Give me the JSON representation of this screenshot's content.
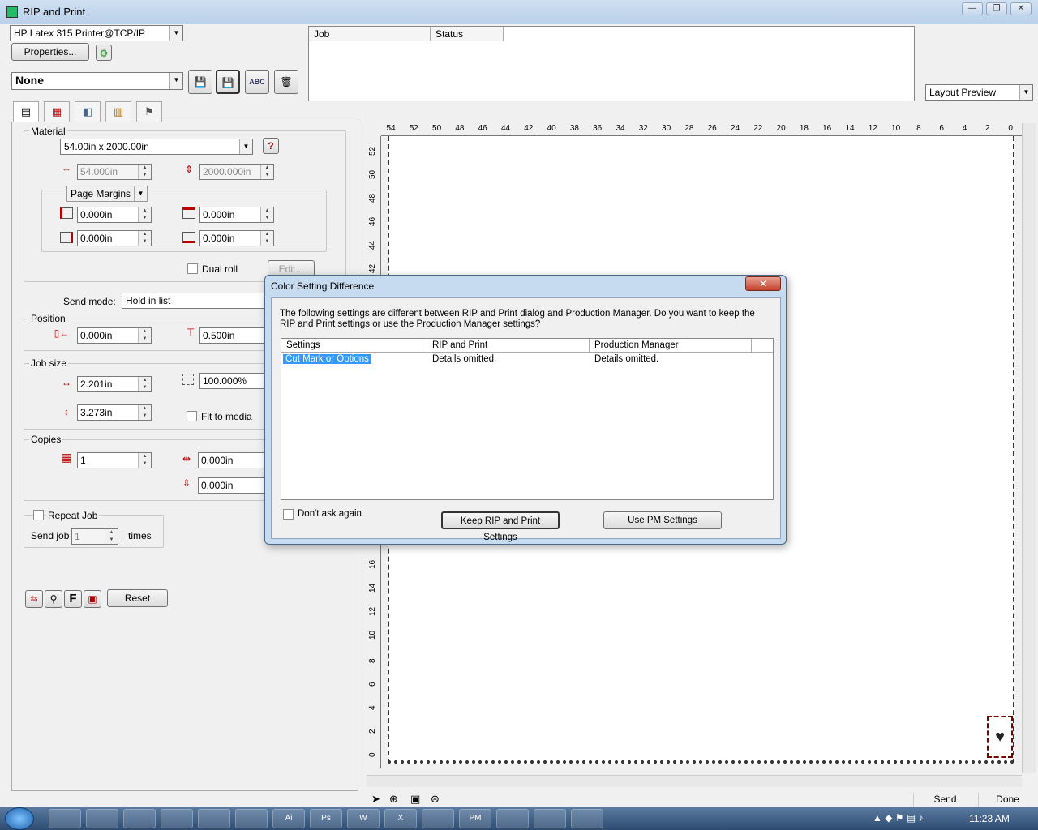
{
  "window": {
    "title": "RIP and Print",
    "min": "—",
    "max": "❐",
    "close": "✕"
  },
  "printer": {
    "selected": "HP Latex 315 Printer@TCP/IP",
    "properties_label": "Properties..."
  },
  "preset": {
    "selected": "None",
    "color": "#90ee90"
  },
  "toolbar_icons": [
    "save-icon",
    "save-as-icon",
    "rename-icon",
    "delete-icon"
  ],
  "toolbar_glyphs": {
    "save": "💾",
    "save_as": "💾",
    "rename": "ABC",
    "delete": "🗑"
  },
  "tab_glyphs": [
    "▤",
    "▦",
    "◧",
    "▥",
    "⚑"
  ],
  "job_table": {
    "columns": [
      "Job",
      "Status"
    ]
  },
  "view_select": "Layout Preview",
  "material": {
    "group_label": "Material",
    "size": "54.00in x 2000.00in",
    "width": "54.000in",
    "height": "2000.000in",
    "margins_mode": "Page Margins",
    "margin_left": "0.000in",
    "margin_top": "0.000in",
    "margin_right": "0.000in",
    "margin_bottom": "0.000in",
    "dual_roll_label": "Dual roll",
    "edit_label": "Edit..."
  },
  "send_mode": {
    "label": "Send mode:",
    "value": "Hold in list"
  },
  "position": {
    "group_label": "Position",
    "x": "0.000in",
    "y": "0.500in"
  },
  "job_size": {
    "group_label": "Job size",
    "width": "2.201in",
    "height": "3.273in",
    "scale": "100.000%",
    "fit_label": "Fit to media"
  },
  "copies": {
    "group_label": "Copies",
    "count": "1",
    "h_gap": "0.000in",
    "v_gap": "0.000in"
  },
  "repeat": {
    "label": "Repeat Job",
    "send_job_label": "Send job",
    "times_value": "1",
    "times_label": "times"
  },
  "bottom_tools": {
    "f_label": "F",
    "reset_label": "Reset"
  },
  "ruler": {
    "h_ticks": [
      "54",
      "52",
      "50",
      "48",
      "46",
      "44",
      "42",
      "40",
      "38",
      "36",
      "34",
      "32",
      "30",
      "28",
      "26",
      "24",
      "22",
      "20",
      "18",
      "16",
      "14",
      "12",
      "10",
      "8",
      "6",
      "4",
      "2",
      "0"
    ],
    "v_ticks_top": [
      "52",
      "50",
      "48",
      "46",
      "44",
      "42"
    ],
    "v_ticks_bottom": [
      "16",
      "14",
      "12",
      "10",
      "8",
      "6",
      "4",
      "2",
      "0"
    ]
  },
  "status_buttons": {
    "send": "Send",
    "done": "Done"
  },
  "dialog": {
    "title": "Color Setting Difference",
    "close": "✕",
    "message": "The following settings are different between RIP and Print dialog and Production Manager. Do you want to keep the RIP and Print settings or use the Production Manager settings?",
    "columns": [
      "Settings",
      "RIP and Print",
      "Production Manager"
    ],
    "row": {
      "setting": "Cut Mark or Options",
      "rip": "Details omitted.",
      "pm": "Details omitted."
    },
    "dont_ask_label": "Don't ask again",
    "keep_label": "Keep RIP and Print Settings",
    "use_pm_label": "Use PM Settings"
  },
  "taskbar": {
    "items": [
      "explorer",
      "chrome",
      "app",
      "rip-print",
      "sun",
      "xara",
      "Ai",
      "Ps",
      "W",
      "X",
      "calc",
      "PM",
      "app2",
      "app3",
      "app4"
    ],
    "labels": [
      "",
      "",
      "",
      "",
      "",
      "",
      "Ai",
      "Ps",
      "W",
      "X",
      "",
      "PM",
      "",
      "",
      ""
    ],
    "clock": "11:23 AM"
  }
}
